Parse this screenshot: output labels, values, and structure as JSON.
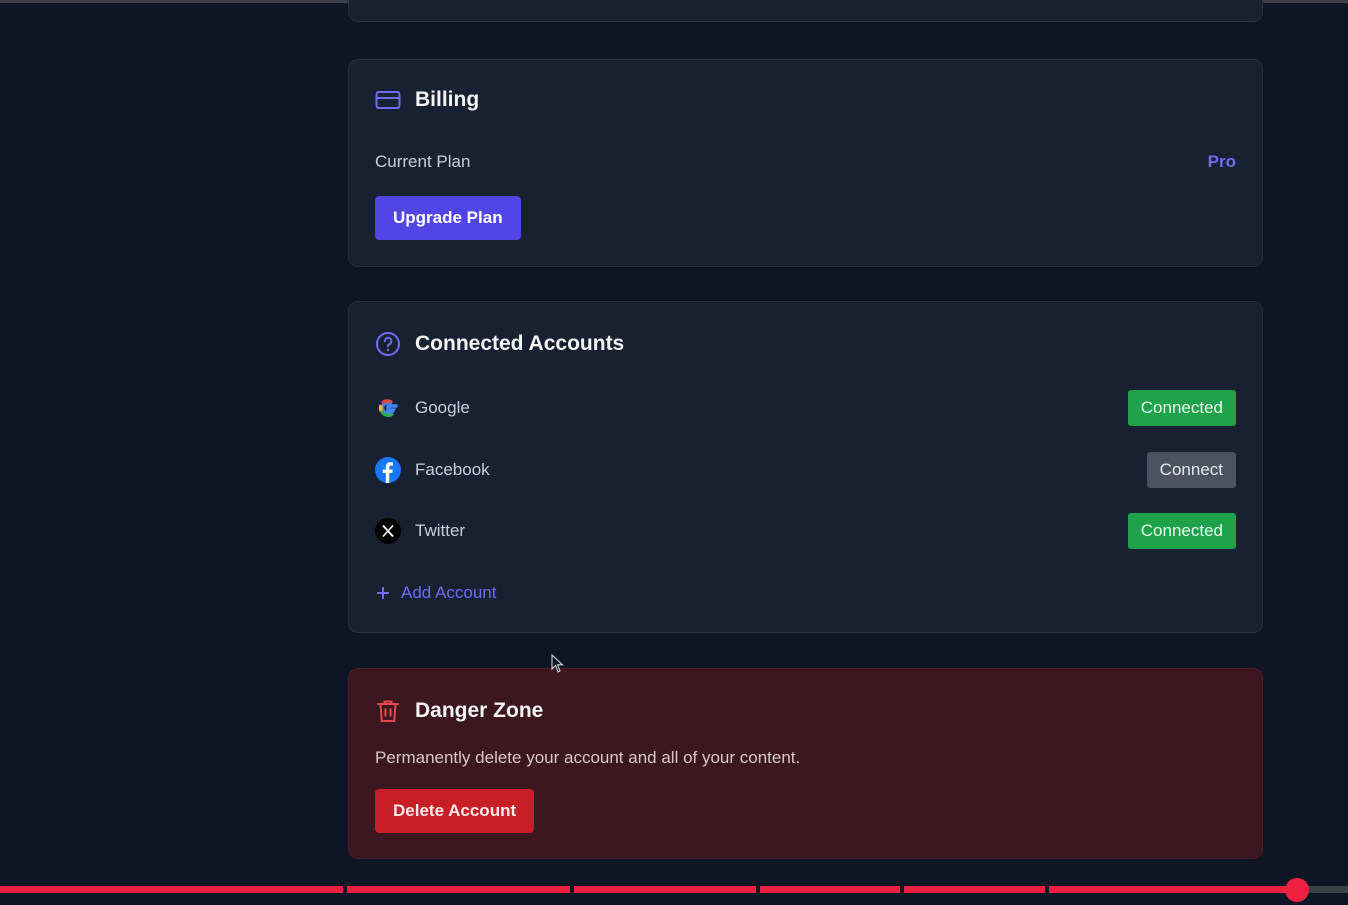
{
  "billing": {
    "title": "Billing",
    "current_plan_label": "Current Plan",
    "current_plan_value": "Pro",
    "upgrade_button": "Upgrade Plan"
  },
  "accounts": {
    "title": "Connected Accounts",
    "items": [
      {
        "name": "Google",
        "button": "Connected",
        "status": "connected"
      },
      {
        "name": "Facebook",
        "button": "Connect",
        "status": "not-connected"
      },
      {
        "name": "Twitter",
        "button": "Connected",
        "status": "connected"
      }
    ],
    "add_account": "Add Account"
  },
  "danger": {
    "title": "Danger Zone",
    "description": "Permanently delete your account and all of your content.",
    "delete_button": "Delete Account"
  },
  "video_progress": {
    "played_fraction": 0.962,
    "chapter_markers": [
      0.256,
      0.424,
      0.562,
      0.669,
      0.777
    ]
  },
  "colors": {
    "accent": "#4f46e5",
    "accent_text": "#6f6cf2",
    "connected": "#1fa34a",
    "danger": "#c81f27",
    "progress": "#ee1f3f"
  }
}
